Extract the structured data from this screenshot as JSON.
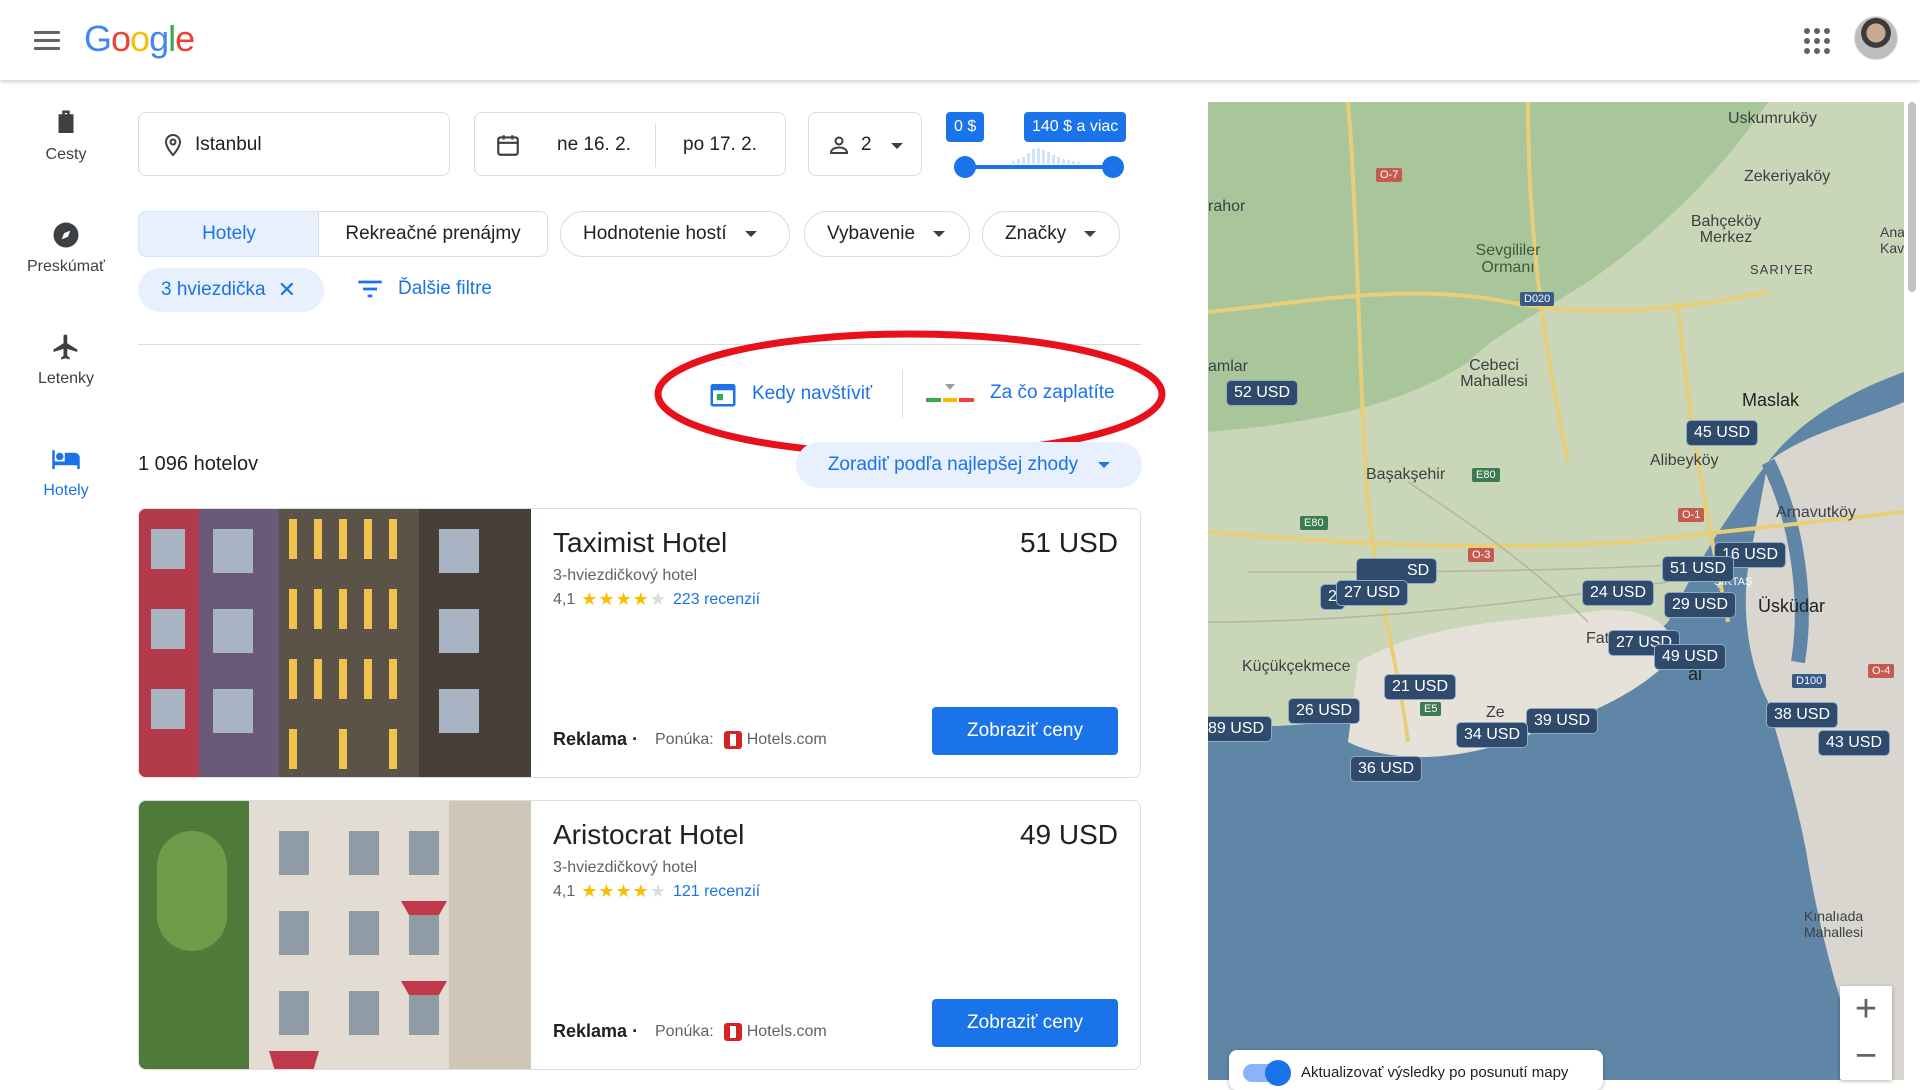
{
  "header": {
    "logo": "Google",
    "menu_icon": "hamburger-icon",
    "apps_icon": "apps-grid-icon"
  },
  "nav": [
    {
      "label": "Cesty",
      "icon": "luggage-icon"
    },
    {
      "label": "Preskúmať",
      "icon": "compass-icon"
    },
    {
      "label": "Letenky",
      "icon": "airplane-icon"
    },
    {
      "label": "Hotely",
      "icon": "bed-icon",
      "active": true
    }
  ],
  "search": {
    "location": "Istanbul",
    "checkin": "ne 16. 2.",
    "checkout": "po 17. 2.",
    "guests": "2",
    "price_min_label": "0 $",
    "price_max_label": "140 $ a viac"
  },
  "filters": {
    "tab_hotels": "Hotely",
    "tab_rentals": "Rekreačné prenájmy",
    "guest_rating": "Hodnotenie hostí",
    "amenities": "Vybavenie",
    "brands": "Značky",
    "active_chip": "3 hviezdička",
    "more_filters": "Ďalšie filtre"
  },
  "insights": {
    "when_to_visit": "Kedy navštíviť",
    "what_you_pay": "Za čo zaplatíte",
    "highlight_color": "#e8101a"
  },
  "results": {
    "count": "1 096 hotelov",
    "sort": "Zoradiť podľa najlepšej zhody"
  },
  "hotels": [
    {
      "name": "Taximist Hotel",
      "price": "51 USD",
      "class": "3-hviezdičkový hotel",
      "rating": "4,1",
      "stars": 4,
      "reviews": "223 recenzií",
      "ad": "Reklama",
      "offer_label": "Ponúka:",
      "offer_source": "Hotels.com",
      "button": "Zobraziť ceny"
    },
    {
      "name": "Aristocrat Hotel",
      "price": "49 USD",
      "class": "3-hviezdičkový hotel",
      "rating": "4,1",
      "stars": 4,
      "reviews": "121 recenzií",
      "ad": "Reklama",
      "offer_label": "Ponúka:",
      "offer_source": "Hotels.com",
      "button": "Zobraziť ceny"
    }
  ],
  "map": {
    "labels": [
      "Uskumruköy",
      "Zekeriyaköy",
      "Bahçeköy Merkez",
      "Sevgililer Ormanı",
      "Cebeci Mahallesi",
      "Maslak",
      "Başakşehir",
      "Alibeyköy",
      "Arnavutköy",
      "Üsküdar",
      "Küçükçekmece",
      "Kınalıada Mahallesi",
      "SARIYER",
      "D020",
      "E80",
      "O-7",
      "O-1",
      "O-3",
      "E5",
      "D100",
      "O-4"
    ],
    "label_clipped": [
      "rahor",
      "amlar",
      "Fat",
      "Ze",
      "Ana Kav",
      "ŞİKTAŞ",
      "al"
    ],
    "pins": [
      "52 USD",
      "45 USD",
      "16 USD",
      "51 USD",
      "29 USD",
      "24 USD",
      "2",
      "27 USD",
      "SD",
      "27 USD",
      "49 USD",
      "21 USD",
      "26 USD",
      "39 USD",
      "34 USD",
      "89 USD",
      "36 USD",
      "38 USD",
      "43 USD"
    ],
    "update_toggle": "Aktualizovať výsledky po posunutí mapy",
    "zoom_in": "+",
    "zoom_out": "−"
  }
}
